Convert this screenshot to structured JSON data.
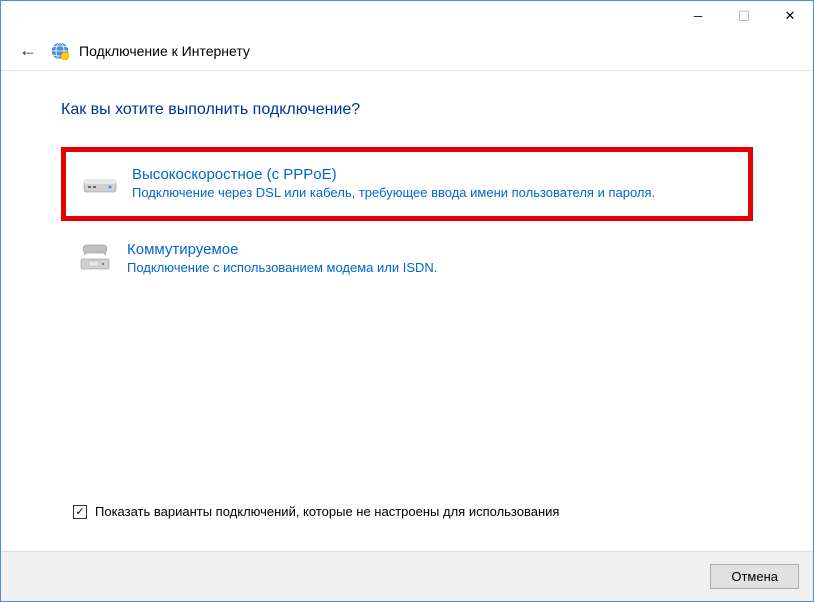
{
  "window": {
    "title": "Подключение к Интернету"
  },
  "main": {
    "question": "Как вы хотите выполнить подключение?",
    "options": [
      {
        "title": "Высокоскоростное (с PPPoE)",
        "description": "Подключение через DSL или кабель, требующее ввода имени пользователя и пароля."
      },
      {
        "title": "Коммутируемое",
        "description": "Подключение с использованием модема или ISDN."
      }
    ]
  },
  "checkbox": {
    "label": "Показать варианты подключений, которые не настроены для использования",
    "checked": true
  },
  "footer": {
    "cancel": "Отмена"
  }
}
